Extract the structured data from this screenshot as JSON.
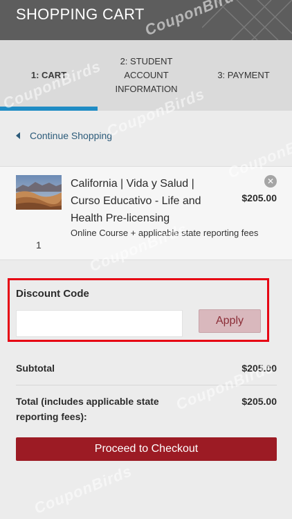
{
  "header": {
    "title": "SHOPPING CART"
  },
  "steps": [
    {
      "label": "1: CART",
      "active": true
    },
    {
      "label": "2: STUDENT ACCOUNT INFORMATION",
      "active": false
    },
    {
      "label": "3: PAYMENT",
      "active": false
    }
  ],
  "nav": {
    "continue_label": "Continue Shopping"
  },
  "cart_item": {
    "title": "California | Vida y Salud | Curso Educativo - Life and Health Pre-licensing",
    "subtitle": "Online Course + applicable state reporting fees",
    "price": "$205.00",
    "quantity": "1",
    "thumbnail": "desert-dunes-image",
    "remove_icon": "close-circle-icon"
  },
  "discount": {
    "label": "Discount Code",
    "value": "",
    "placeholder": "",
    "apply_label": "Apply"
  },
  "summary": {
    "subtotal_label": "Subtotal",
    "subtotal_value": "$205.00",
    "total_label": "Total (includes applicable state reporting fees):",
    "total_value": "$205.00"
  },
  "checkout_label": "Proceed to Checkout",
  "watermark_text": "CouponBirds",
  "colors": {
    "header_bg": "#5d5d5d",
    "active_step_bar": "#1f8cc4",
    "checkout_bg": "#9c1b24",
    "apply_bg": "#d9b8bd",
    "highlight_border": "#e60012"
  }
}
